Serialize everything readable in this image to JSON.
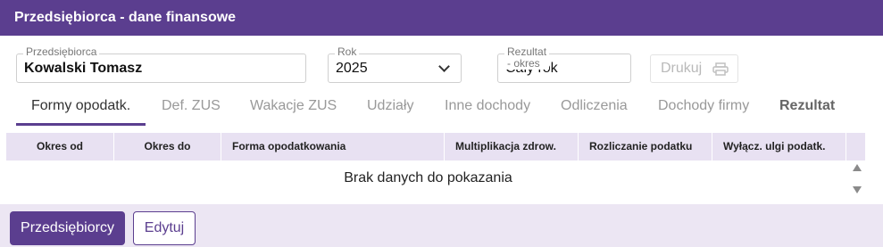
{
  "window": {
    "title": "Przedsiębiorca - dane finansowe"
  },
  "form": {
    "entrepreneur_label": "Przedsiębiorca",
    "entrepreneur_value": "Kowalski Tomasz",
    "year_label": "Rok",
    "year_value": "2025",
    "result_label": "Rezultat - okres",
    "result_value": "Cały rok",
    "print_label": "Drukuj",
    "print_icon": "printer-icon"
  },
  "tabs": [
    {
      "label": "Formy opodatk."
    },
    {
      "label": "Def. ZUS"
    },
    {
      "label": "Wakacje ZUS"
    },
    {
      "label": "Udziały"
    },
    {
      "label": "Inne dochody"
    },
    {
      "label": "Odliczenia"
    },
    {
      "label": "Dochody firmy"
    },
    {
      "label": "Rezultat"
    }
  ],
  "active_tab": "Formy opodatk.",
  "grid": {
    "columns": [
      "Okres od",
      "Okres do",
      "Forma opodatkowania",
      "Multiplikacja zdrow.",
      "Rozliczanie podatku",
      "Wyłącz. ulgi podatk."
    ],
    "empty_text": "Brak danych do pokazania"
  },
  "footer": {
    "primary_label": "Przedsiębiorcy",
    "secondary_label": "Edytuj"
  },
  "colors": {
    "accent": "#5b3e8f",
    "header_bg": "#e8e1f2",
    "footer_bg": "#ece6f3"
  }
}
